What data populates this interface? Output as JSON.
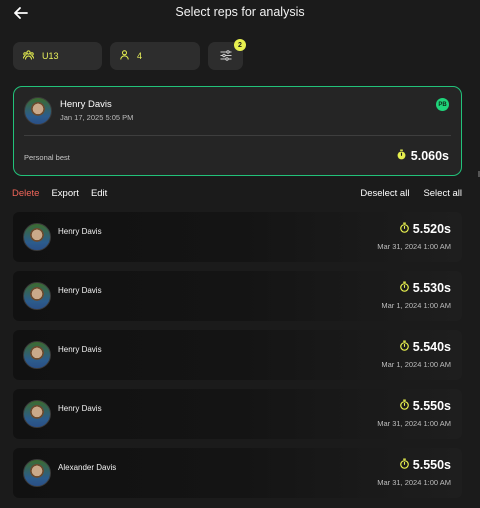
{
  "header": {
    "title": "Select reps for analysis"
  },
  "filters": {
    "team": "U13",
    "count": "4",
    "filter_badge": "2"
  },
  "personal_best": {
    "athlete": "Henry Davis",
    "date": "Jan 17, 2025 5:05 PM",
    "badge": "PB",
    "label": "Personal best",
    "time": "5.060s"
  },
  "actions": {
    "delete": "Delete",
    "export": "Export",
    "edit": "Edit",
    "deselect_all": "Deselect all",
    "select_all": "Select all"
  },
  "reps": [
    {
      "athlete": "Henry Davis",
      "time": "5.520s",
      "date": "Mar 31, 2024 1:00 AM"
    },
    {
      "athlete": "Henry Davis",
      "time": "5.530s",
      "date": "Mar 1, 2024 1:00 AM"
    },
    {
      "athlete": "Henry Davis",
      "time": "5.540s",
      "date": "Mar 1, 2024 1:00 AM"
    },
    {
      "athlete": "Henry Davis",
      "time": "5.550s",
      "date": "Mar 31, 2024 1:00 AM"
    },
    {
      "athlete": "Alexander Davis",
      "time": "5.550s",
      "date": "Mar 31, 2024 1:00 AM"
    }
  ],
  "colors": {
    "accent": "#e7f04f",
    "pb_green": "#22c27a",
    "delete_red": "#f1665a"
  }
}
